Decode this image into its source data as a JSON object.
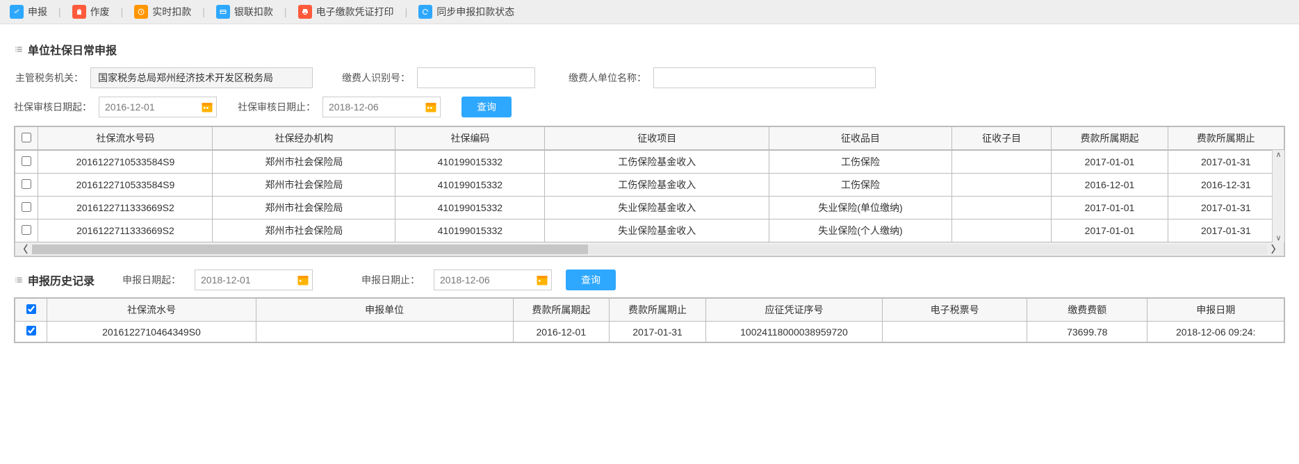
{
  "colors": {
    "accent_blue": "#2ea7ff",
    "icon_orange": "#ff9600",
    "icon_red": "#ff5a3c",
    "icon_teal": "#2ea7ff"
  },
  "toolbar": [
    {
      "icon": "check",
      "bg": "#2ea7ff",
      "label": "申报"
    },
    {
      "icon": "trash",
      "bg": "#ff5a3c",
      "label": "作废"
    },
    {
      "icon": "clock",
      "bg": "#ff9600",
      "label": "实时扣款"
    },
    {
      "icon": "card",
      "bg": "#2ea7ff",
      "label": "银联扣款"
    },
    {
      "icon": "print",
      "bg": "#ff5a3c",
      "label": "电子缴款凭证打印"
    },
    {
      "icon": "sync",
      "bg": "#2ea7ff",
      "label": "同步申报扣款状态"
    }
  ],
  "section1_title": "单位社保日常申报",
  "form1": {
    "tax_authority_label": "主管税务机关：",
    "tax_authority_value": "国家税务总局郑州经济技术开发区税务局",
    "payer_id_label": "缴费人识别号：",
    "payer_id_value": "",
    "payer_name_label": "缴费人单位名称：",
    "payer_name_value": "",
    "date_from_label": "社保审核日期起：",
    "date_from_value": "2016-12-01",
    "date_to_label": "社保审核日期止：",
    "date_to_value": "2018-12-06",
    "query": "查询"
  },
  "table1": {
    "headers": [
      "社保流水号码",
      "社保经办机构",
      "社保编码",
      "征收项目",
      "征收品目",
      "征收子目",
      "费款所属期起",
      "费款所属期止"
    ],
    "rows": [
      [
        "2016122710533584S9",
        "郑州市社会保险局",
        "410199015332",
        "工伤保险基金收入",
        "工伤保险",
        "",
        "2017-01-01",
        "2017-01-31"
      ],
      [
        "2016122710533584S9",
        "郑州市社会保险局",
        "410199015332",
        "工伤保险基金收入",
        "工伤保险",
        "",
        "2016-12-01",
        "2016-12-31"
      ],
      [
        "2016122711333669S2",
        "郑州市社会保险局",
        "410199015332",
        "失业保险基金收入",
        "失业保险(单位缴纳)",
        "",
        "2017-01-01",
        "2017-01-31"
      ],
      [
        "2016122711333669S2",
        "郑州市社会保险局",
        "410199015332",
        "失业保险基金收入",
        "失业保险(个人缴纳)",
        "",
        "2017-01-01",
        "2017-01-31"
      ]
    ]
  },
  "section2_title": "申报历史记录",
  "form2": {
    "date_from_label": "申报日期起：",
    "date_from_value": "2018-12-01",
    "date_to_label": "申报日期止：",
    "date_to_value": "2018-12-06",
    "query": "查询"
  },
  "table2": {
    "headers": [
      "社保流水号",
      "申报单位",
      "费款所属期起",
      "费款所属期止",
      "应征凭证序号",
      "电子税票号",
      "缴费费额",
      "申报日期"
    ],
    "rows": [
      [
        "2016122710464349S0",
        "",
        "2016-12-01",
        "2017-01-31",
        "10024118000038959720",
        "",
        "73699.78",
        "2018-12-06 09:24:"
      ]
    ]
  }
}
